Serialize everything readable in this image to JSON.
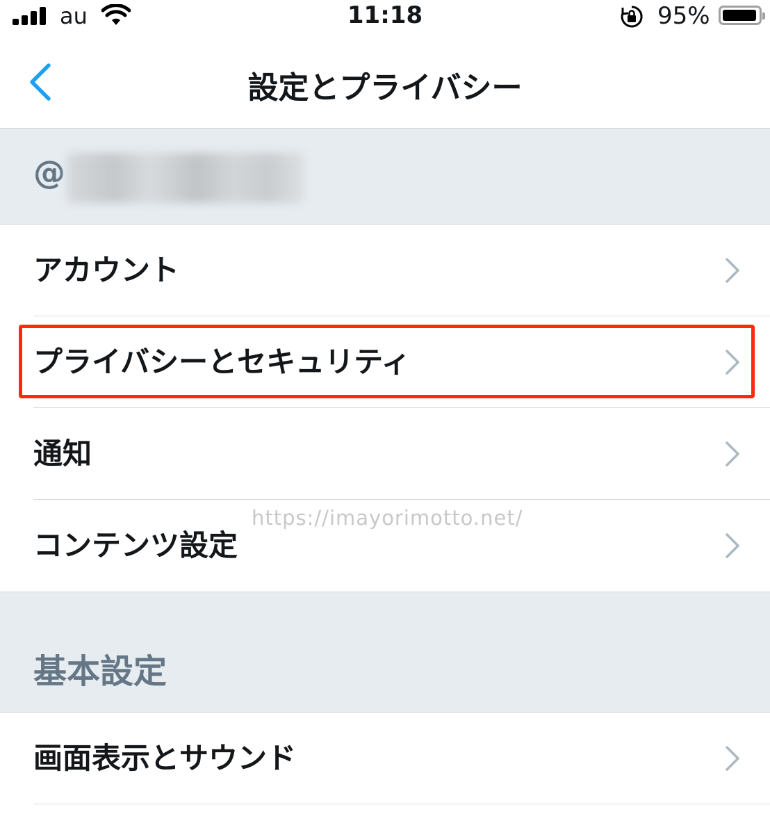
{
  "status_bar": {
    "carrier": "au",
    "time": "11:18",
    "battery_percent": "95%",
    "battery_level": 0.95,
    "icons": [
      "signal-icon",
      "wifi-icon",
      "rotation-lock-icon",
      "battery-icon"
    ]
  },
  "nav": {
    "back_icon": "chevron-left-icon",
    "title": "設定とプライバシー"
  },
  "account": {
    "handle_prefix": "@"
  },
  "menu_items": [
    {
      "label": "アカウント"
    },
    {
      "label": "プライバシーとセキュリティ"
    },
    {
      "label": "通知"
    },
    {
      "label": "コンテンツ設定"
    }
  ],
  "watermark": "https://imayorimotto.net/",
  "basic_section": {
    "title": "基本設定",
    "items": [
      {
        "label": "画面表示とサウンド"
      }
    ]
  },
  "colors": {
    "accent": "#1da1f2",
    "highlight": "#ff2a0c",
    "section_bg": "#e6ecf0",
    "secondary_text": "#657786"
  }
}
